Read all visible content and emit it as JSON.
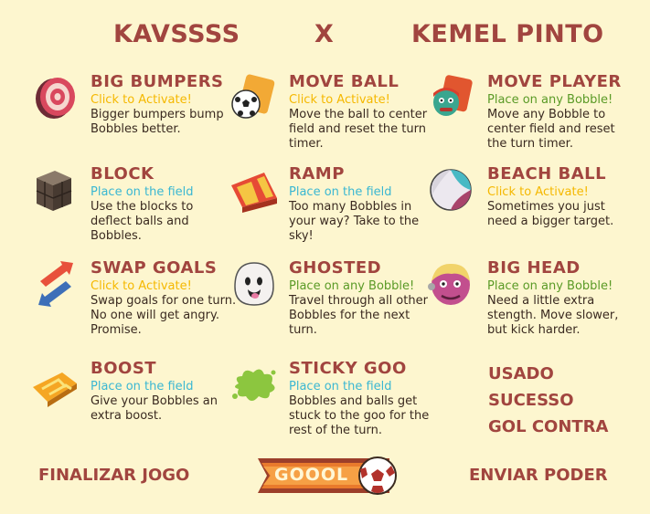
{
  "header": {
    "player1": "KAVSSSS",
    "versus": "X",
    "player2": "KEMEL PINTO"
  },
  "colors": {
    "title": "#a1453f",
    "activate": "#f5b800",
    "place_field": "#3ab7d2",
    "place_bobble": "#5a9a26",
    "desc": "#3a2a20"
  },
  "powers": [
    {
      "name": "BIG BUMPERS",
      "hint": "Click to Activate!",
      "hint_type": "activate",
      "desc": "Bigger bumpers bump Bobbles better.",
      "icon": "bumper-icon"
    },
    {
      "name": "MOVE BALL",
      "hint": "Click to Activate!",
      "hint_type": "activate",
      "desc": "Move the ball to center field and reset the turn timer.",
      "icon": "move-ball-icon"
    },
    {
      "name": "MOVE PLAYER",
      "hint": "Place on any Bobble!",
      "hint_type": "bobble",
      "desc": "Move any Bobble to center field and reset the turn timer.",
      "icon": "move-player-icon"
    },
    {
      "name": "BLOCK",
      "hint": "Place on the field",
      "hint_type": "field",
      "desc": "Use the blocks to deflect balls and Bobbles.",
      "icon": "block-icon"
    },
    {
      "name": "RAMP",
      "hint": "Place on the field",
      "hint_type": "field",
      "desc": "Too many Bobbles in your way? Take to the sky!",
      "icon": "ramp-icon"
    },
    {
      "name": "BEACH BALL",
      "hint": "Click to Activate!",
      "hint_type": "activate",
      "desc": "Sometimes you just need a bigger target.",
      "icon": "beach-ball-icon"
    },
    {
      "name": "SWAP GOALS",
      "hint": "Click to Activate!",
      "hint_type": "activate",
      "desc": "Swap goals for one turn. No one will get angry. Promise.",
      "icon": "swap-arrows-icon"
    },
    {
      "name": "GHOSTED",
      "hint": "Place on any Bobble!",
      "hint_type": "bobble",
      "desc": "Travel through all other Bobbles for the next turn.",
      "icon": "ghost-icon"
    },
    {
      "name": "BIG HEAD",
      "hint": "Place on any Bobble!",
      "hint_type": "bobble",
      "desc": "Need a little extra stength. Move slower, but kick harder.",
      "icon": "big-head-icon"
    },
    {
      "name": "BOOST",
      "hint": "Place on the field",
      "hint_type": "field",
      "desc": "Give your Bobbles an extra boost.",
      "icon": "boost-chevron-icon"
    },
    {
      "name": "STICKY GOO",
      "hint": "Place on the field",
      "hint_type": "field",
      "desc": "Bobbles and balls get stuck to the goo for the rest of the turn.",
      "icon": "goo-splat-icon"
    }
  ],
  "status": {
    "used": "USADO",
    "success": "SUCESSO",
    "own_goal": "GOL CONTRA"
  },
  "footer": {
    "finish": "FINALIZAR JOGO",
    "goal": "GOOOL",
    "send": "ENVIAR PODER"
  }
}
